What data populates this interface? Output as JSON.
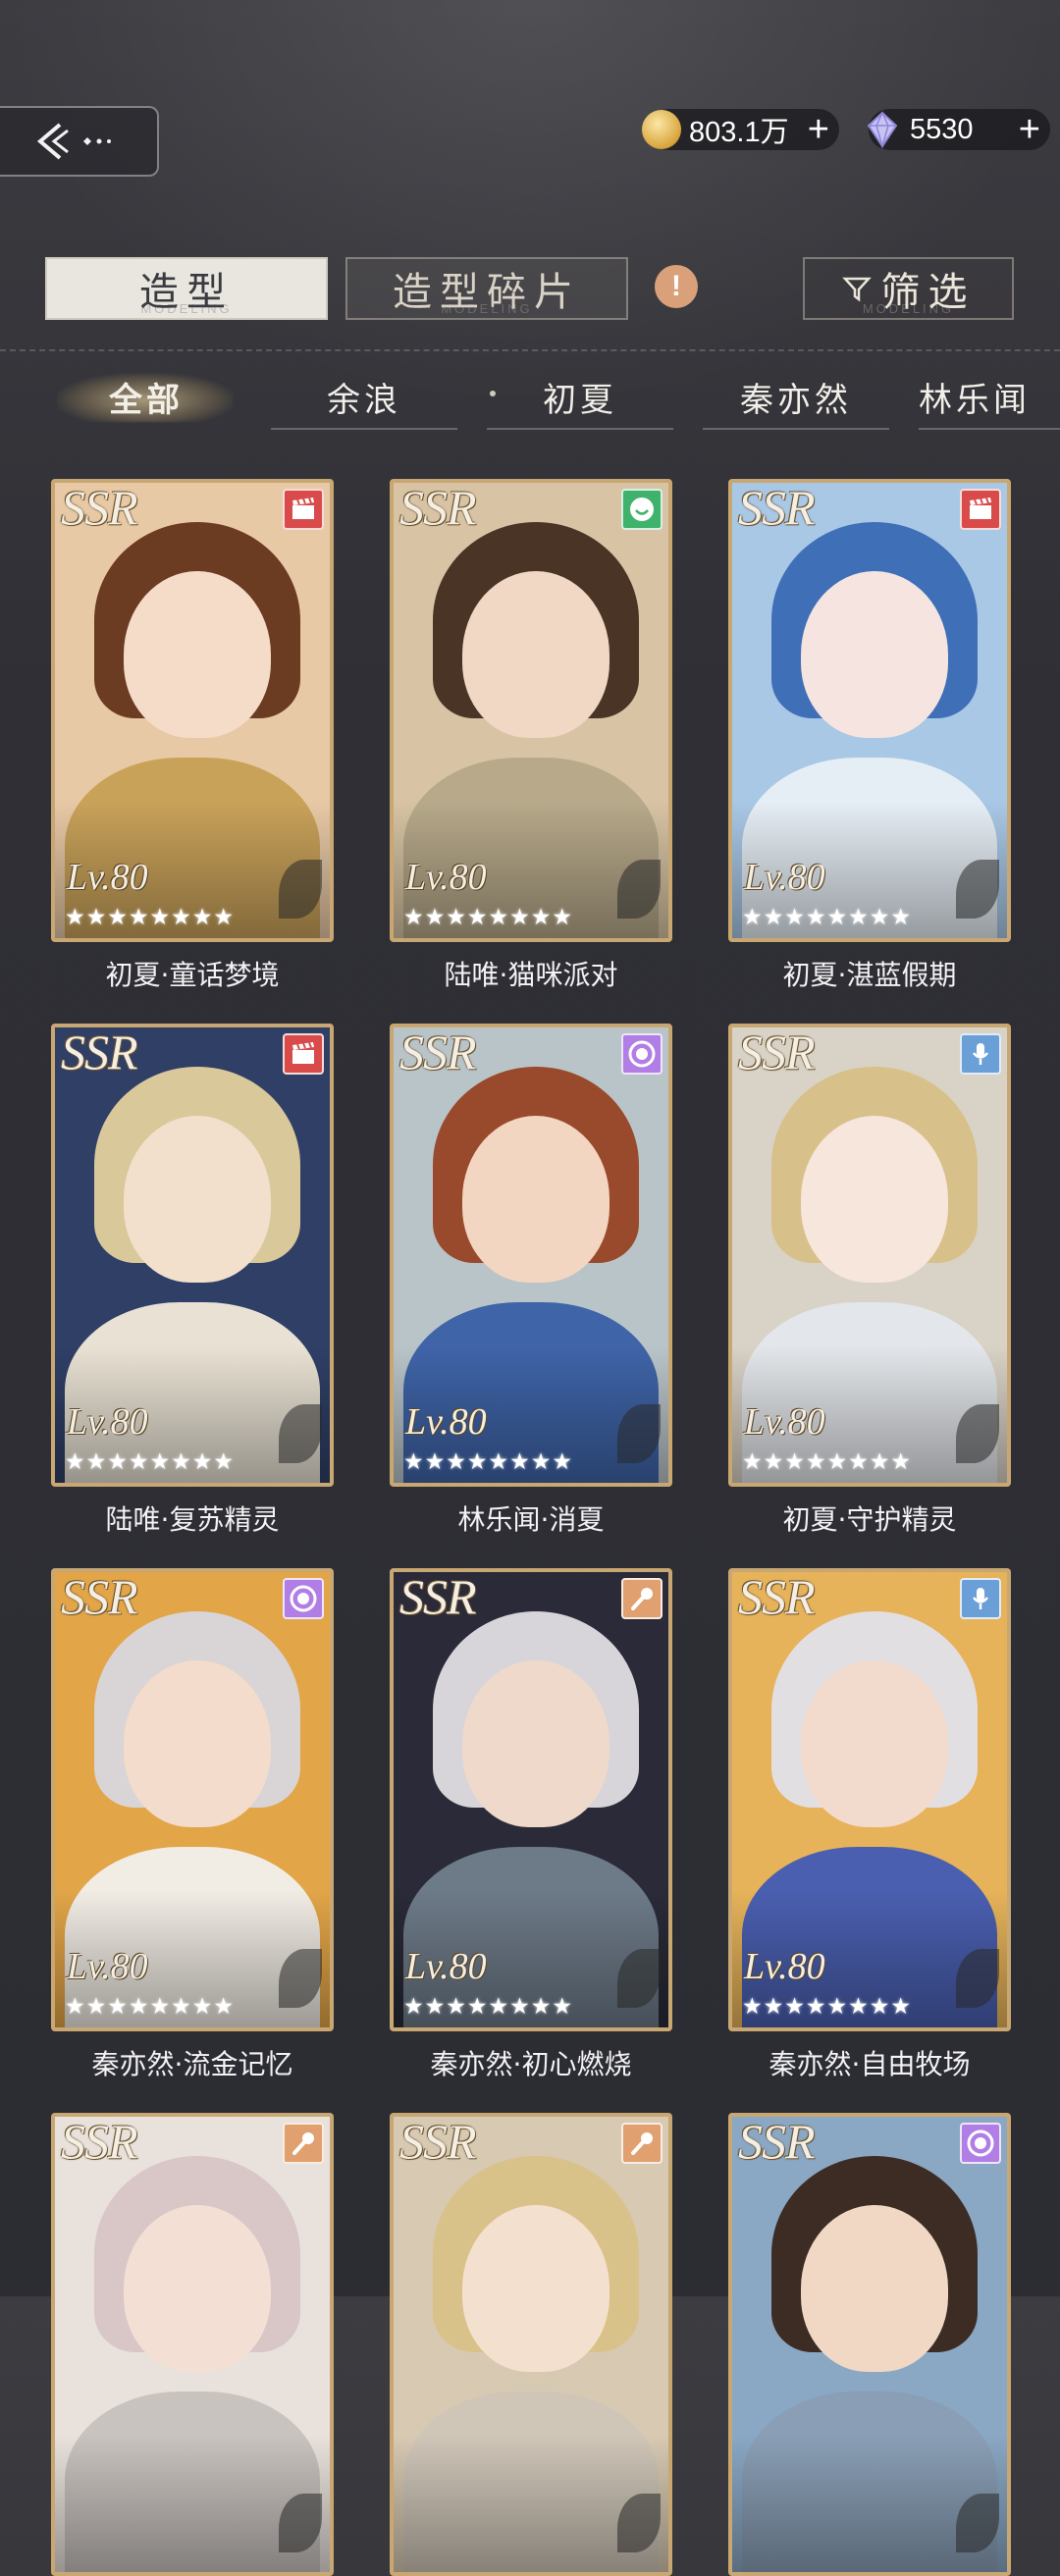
{
  "currencies": {
    "gold": {
      "amount": "803.1万",
      "plus": "+"
    },
    "gems": {
      "amount": "5530",
      "plus": "+"
    }
  },
  "tabs": {
    "costume": {
      "label": "造型",
      "sub": "MODELING"
    },
    "fragments": {
      "label": "造型碎片",
      "sub": "MODELING"
    },
    "alert": "!",
    "filter": {
      "label": "筛选",
      "sub": "MODELING"
    }
  },
  "characters": [
    {
      "label": "全部"
    },
    {
      "label": "余浪"
    },
    {
      "label": "初夏"
    },
    {
      "label": "秦亦然"
    },
    {
      "label": "林乐闻"
    }
  ],
  "cards": [
    {
      "rarity": "SSR",
      "level": "Lv.80",
      "stars": "★★★★★★★★",
      "name": "初夏·童话梦境",
      "icon": "video-icon",
      "colors": {
        "bg": "#e8c9a6",
        "hair": "#6b3b22",
        "skin": "#f4dcc8",
        "cloth": "#c9a25a"
      }
    },
    {
      "rarity": "SSR",
      "level": "Lv.80",
      "stars": "★★★★★★★★",
      "name": "陆唯·猫咪派对",
      "icon": "smile-icon",
      "colors": {
        "bg": "#d8c4a4",
        "hair": "#4a3426",
        "skin": "#f1d8c4",
        "cloth": "#b7a98a"
      }
    },
    {
      "rarity": "SSR",
      "level": "Lv.80",
      "stars": "★★★★★★★★",
      "name": "初夏·湛蓝假期",
      "icon": "video-icon",
      "colors": {
        "bg": "#a9c8e6",
        "hair": "#3f6fb6",
        "skin": "#f5e4e0",
        "cloth": "#e6eef5"
      }
    },
    {
      "rarity": "SSR",
      "level": "Lv.80",
      "stars": "★★★★★★★★",
      "name": "陆唯·复苏精灵",
      "icon": "video-icon",
      "colors": {
        "bg": "#2f3f66",
        "hair": "#d9c89a",
        "skin": "#f2e0cc",
        "cloth": "#e9e2d4"
      }
    },
    {
      "rarity": "SSR",
      "level": "Lv.80",
      "stars": "★★★★★★★★",
      "name": "林乐闻·消夏",
      "icon": "voice-icon",
      "colors": {
        "bg": "#b9c4c9",
        "hair": "#9a4a2c",
        "skin": "#f2d6c2",
        "cloth": "#3f64a8"
      }
    },
    {
      "rarity": "SSR",
      "level": "Lv.80",
      "stars": "★★★★★★★★",
      "name": "初夏·守护精灵",
      "icon": "mic-blue-icon",
      "colors": {
        "bg": "#d9d2c6",
        "hair": "#d8c08a",
        "skin": "#f6e6dc",
        "cloth": "#e3e6ea"
      }
    },
    {
      "rarity": "SSR",
      "level": "Lv.80",
      "stars": "★★★★★★★★",
      "name": "秦亦然·流金记忆",
      "icon": "voice-icon",
      "colors": {
        "bg": "#e2a548",
        "hair": "#d9d4d6",
        "skin": "#f3dccb",
        "cloth": "#f1ece4"
      }
    },
    {
      "rarity": "SSR",
      "level": "Lv.80",
      "stars": "★★★★★★★★",
      "name": "秦亦然·初心燃烧",
      "icon": "mic-icon",
      "colors": {
        "bg": "#2a2a38",
        "hair": "#d7d5da",
        "skin": "#efd9cb",
        "cloth": "#6d7a88"
      }
    },
    {
      "rarity": "SSR",
      "level": "Lv.80",
      "stars": "★★★★★★★★",
      "name": "秦亦然·自由牧场",
      "icon": "mic-blue-icon",
      "colors": {
        "bg": "#e6b35a",
        "hair": "#e2dfe3",
        "skin": "#f2dbcc",
        "cloth": "#4a5fb0"
      }
    },
    {
      "rarity": "SSR",
      "level": "",
      "stars": "",
      "name": "",
      "icon": "mic-icon",
      "colors": {
        "bg": "#e9e2dc",
        "hair": "#d8c7c6",
        "skin": "#f3dfd4",
        "cloth": "#c9c3bf"
      }
    },
    {
      "rarity": "SSR",
      "level": "",
      "stars": "",
      "name": "",
      "icon": "mic-icon",
      "colors": {
        "bg": "#d7c9b2",
        "hair": "#d9c28a",
        "skin": "#f4e0cf",
        "cloth": "#cfc6b8"
      }
    },
    {
      "rarity": "SSR",
      "level": "",
      "stars": "",
      "name": "",
      "icon": "voice-icon",
      "colors": {
        "bg": "#8aa7c4",
        "hair": "#3c2c24",
        "skin": "#f1d8c4",
        "cloth": "#8a9fb6"
      }
    }
  ]
}
